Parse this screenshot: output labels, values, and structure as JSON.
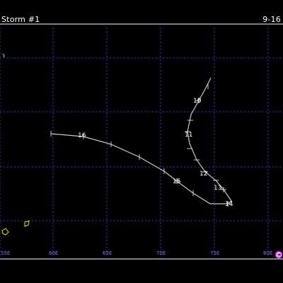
{
  "header": {
    "storm_title": "Storm #1",
    "date_range": "9-16"
  },
  "map": {
    "colors": {
      "background": "#000000",
      "frame": "#ffffff",
      "grid": "#3a35e0",
      "track": "#c8c8c8",
      "labels": "#ffffff",
      "coastline": "#e6e600",
      "ticks": "#7a78ff",
      "logo": "#a000c0"
    },
    "lon_ticks": [
      "55E",
      "60E",
      "65E",
      "70E",
      "75E",
      "80E"
    ],
    "track_day_labels": [
      "10",
      "11",
      "12",
      "13",
      "14",
      "15",
      "16"
    ],
    "logo_icon": "copyright-circle-icon"
  }
}
